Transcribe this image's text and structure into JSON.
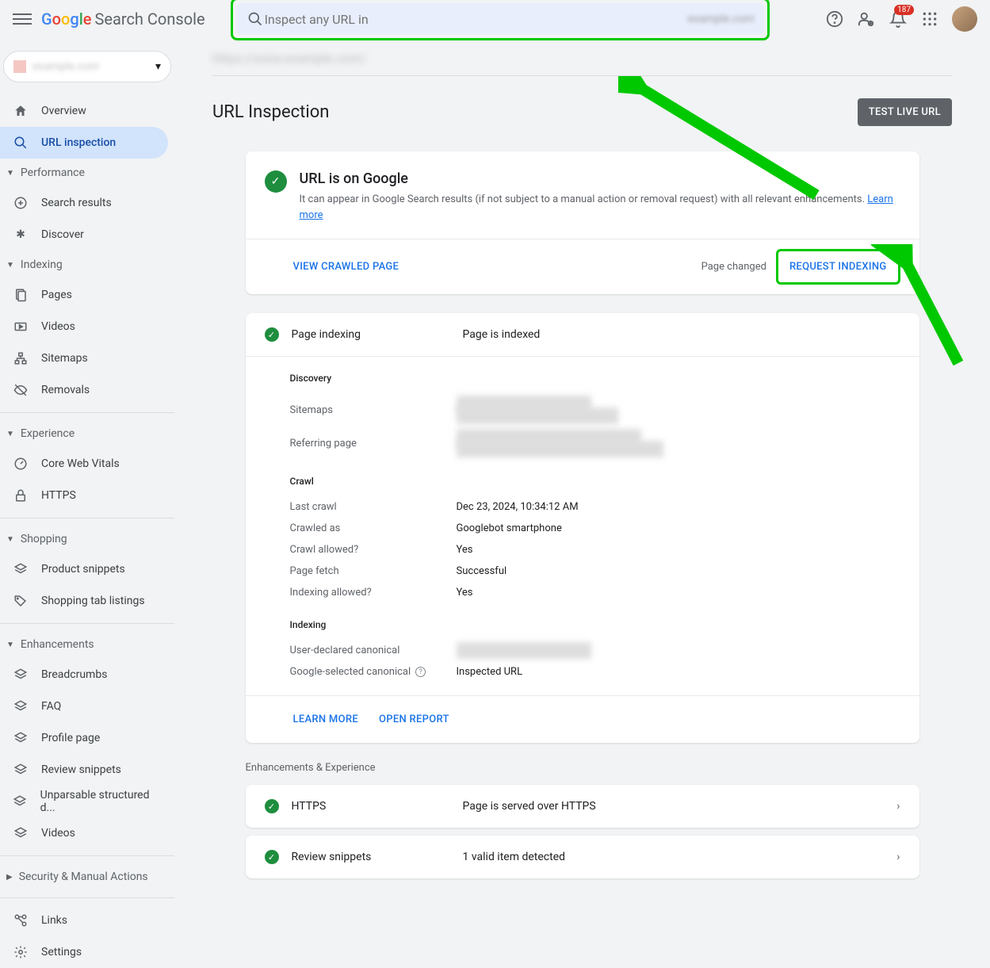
{
  "header": {
    "logo_text": "Search Console",
    "search_placeholder": "Inspect any URL in",
    "notification_count": "187"
  },
  "property": {
    "name": "example.com"
  },
  "sidebar": {
    "overview": "Overview",
    "url_inspection": "URL inspection",
    "performance": "Performance",
    "search_results": "Search results",
    "discover": "Discover",
    "indexing": "Indexing",
    "pages": "Pages",
    "videos": "Videos",
    "sitemaps": "Sitemaps",
    "removals": "Removals",
    "experience": "Experience",
    "cwv": "Core Web Vitals",
    "https": "HTTPS",
    "shopping": "Shopping",
    "product_snippets": "Product snippets",
    "shopping_tab": "Shopping tab listings",
    "enhancements": "Enhancements",
    "breadcrumbs": "Breadcrumbs",
    "faq": "FAQ",
    "profile": "Profile page",
    "review_snippets": "Review snippets",
    "unparsable": "Unparsable structured d...",
    "videos2": "Videos",
    "security": "Security & Manual Actions",
    "links": "Links",
    "settings": "Settings"
  },
  "main": {
    "url": "https://www.example.com/",
    "title": "URL Inspection",
    "test_live": "TEST LIVE URL",
    "status_title": "URL is on Google",
    "status_desc": "It can appear in Google Search results (if not subject to a manual action or removal request) with all relevant enhancements. ",
    "learn_more": "Learn more",
    "view_crawled": "VIEW CRAWLED PAGE",
    "page_changed": "Page changed",
    "request_indexing": "REQUEST INDEXING",
    "page_indexing": "Page indexing",
    "page_indexed": "Page is indexed",
    "discovery": "Discovery",
    "sitemaps_label": "Sitemaps",
    "referring_label": "Referring page",
    "crawl": "Crawl",
    "last_crawl_label": "Last crawl",
    "last_crawl_val": "Dec 23, 2024, 10:34:12 AM",
    "crawled_as_label": "Crawled as",
    "crawled_as_val": "Googlebot smartphone",
    "crawl_allowed_label": "Crawl allowed?",
    "crawl_allowed_val": "Yes",
    "page_fetch_label": "Page fetch",
    "page_fetch_val": "Successful",
    "indexing_allowed_label": "Indexing allowed?",
    "indexing_allowed_val": "Yes",
    "indexing_section": "Indexing",
    "user_canonical_label": "User-declared canonical",
    "google_canonical_label": "Google-selected canonical",
    "google_canonical_val": "Inspected URL",
    "learn_more_btn": "LEARN MORE",
    "open_report": "OPEN REPORT",
    "enhancements_title": "Enhancements & Experience",
    "https_row": "HTTPS",
    "https_val": "Page is served over HTTPS",
    "review_row": "Review snippets",
    "review_val": "1 valid item detected"
  }
}
